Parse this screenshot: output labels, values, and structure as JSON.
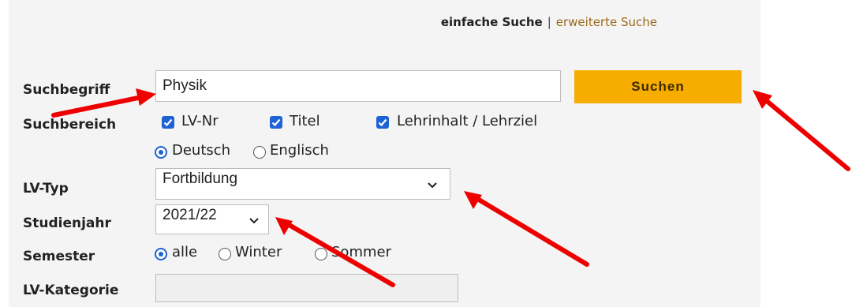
{
  "header": {
    "simple_search": "einfache Suche",
    "separator": "|",
    "advanced_search": "erweiterte Suche"
  },
  "form": {
    "search_term": {
      "label": "Suchbegriff",
      "value": "Physik"
    },
    "search_button": "Suchen",
    "search_area": {
      "label": "Suchbereich",
      "options": [
        {
          "label": "LV-Nr",
          "checked": true
        },
        {
          "label": "Titel",
          "checked": true
        },
        {
          "label": "Lehrinhalt / Lehrziel",
          "checked": true
        }
      ],
      "languages": [
        {
          "label": "Deutsch",
          "selected": true
        },
        {
          "label": "Englisch",
          "selected": false
        }
      ]
    },
    "lv_type": {
      "label": "LV-Typ",
      "value": "Fortbildung"
    },
    "study_year": {
      "label": "Studienjahr",
      "value": "2021/22"
    },
    "semester": {
      "label": "Semester",
      "options": [
        {
          "label": "alle",
          "selected": true
        },
        {
          "label": "Winter",
          "selected": false
        },
        {
          "label": "Sommer",
          "selected": false
        }
      ]
    },
    "lv_category": {
      "label": "LV-Kategorie",
      "value": ""
    }
  },
  "colors": {
    "accent": "#f7ad00",
    "checkbox": "#1e63d6",
    "arrow": "#ee0000",
    "panel": "#f4f4f4"
  }
}
